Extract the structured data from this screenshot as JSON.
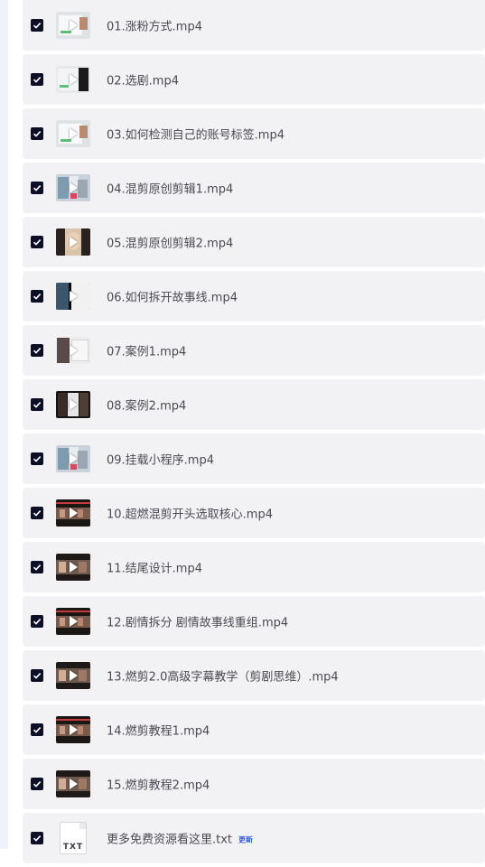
{
  "files": [
    {
      "name": "01.涨粉方式.mp4",
      "thumb": "light",
      "checked": true
    },
    {
      "name": "02.选剧.mp4",
      "thumb": "darkright",
      "checked": true
    },
    {
      "name": "03.如何检测自己的账号标签.mp4",
      "thumb": "light",
      "checked": true
    },
    {
      "name": "04.混剪原创剪辑1.mp4",
      "thumb": "collage",
      "checked": true
    },
    {
      "name": "05.混剪原创剪辑2.mp4",
      "thumb": "portrait",
      "checked": true
    },
    {
      "name": "06.如何拆开故事线.mp4",
      "thumb": "split",
      "checked": true
    },
    {
      "name": "07.案例1.mp4",
      "thumb": "halfpic",
      "checked": true
    },
    {
      "name": "08.案例2.mp4",
      "thumb": "dark",
      "checked": true
    },
    {
      "name": "09.挂载小程序.mp4",
      "thumb": "collage",
      "checked": true
    },
    {
      "name": "10.超燃混剪开头选取核心.mp4",
      "thumb": "film",
      "checked": true
    },
    {
      "name": "11.结尾设计.mp4",
      "thumb": "film2",
      "checked": true
    },
    {
      "name": "12.剧情拆分 剧情故事线重组.mp4",
      "thumb": "film",
      "checked": true
    },
    {
      "name": "13.燃剪2.0高级字幕教学（剪剧思维）.mp4",
      "thumb": "film2",
      "checked": true
    },
    {
      "name": "14.燃剪教程1.mp4",
      "thumb": "film",
      "checked": true
    },
    {
      "name": "15.燃剪教程2.mp4",
      "thumb": "film2",
      "checked": true
    },
    {
      "name": "更多免费资源看这里.txt",
      "thumb": "txt",
      "checked": true,
      "badge": "更新",
      "thumb_label": "TXT"
    }
  ],
  "colors": {
    "row_bg": "#f2f2f4",
    "checkbox": "#0c0f25",
    "text": "#4a4a52",
    "badge": "#3b5bdb"
  },
  "icons": {
    "checkbox": "checkmark-icon",
    "video": "play-icon",
    "text_file": "txt-file-icon"
  }
}
